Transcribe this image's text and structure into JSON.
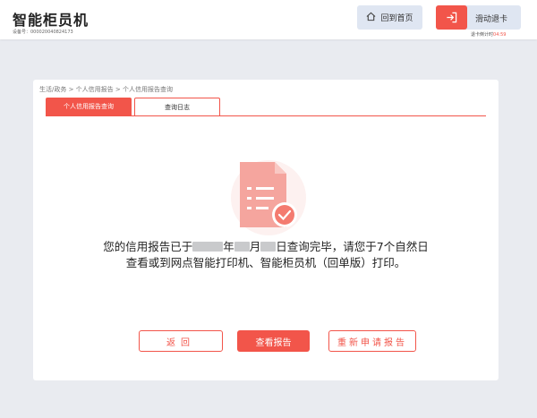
{
  "header": {
    "title": "智能柜员机",
    "device_label": "设备号：000020040824173",
    "home_label": "回到首页",
    "card_label": "滑动退卡",
    "countdown_label": "退卡倒计时",
    "countdown_time": "04:59",
    "accent_color": "#f2554a"
  },
  "breadcrumb": "生活/政务 > 个人信用报告 > 个人信用报告查询",
  "tabs": [
    {
      "label": "个人信用报告查询",
      "active": true
    },
    {
      "label": "查询日志",
      "active": false
    }
  ],
  "message": {
    "part1": "您的信用报告已于",
    "year_suffix": "年",
    "month_suffix": "月",
    "day_suffix": "日查询完毕，请您于7个自然日",
    "line2": "查看或到网点智能打印机、智能柜员机（回单版）打印。"
  },
  "buttons": {
    "back": "返回",
    "view": "查看报告",
    "reapply": "重新申请报告"
  },
  "icons": {
    "home": "home-icon",
    "exit": "exit-icon",
    "report": "report-check-icon"
  }
}
